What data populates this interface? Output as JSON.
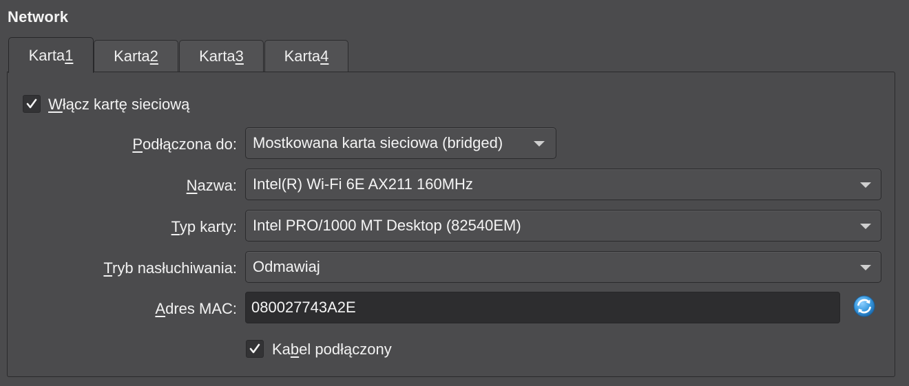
{
  "section": {
    "title": "Network"
  },
  "tabs": [
    {
      "prefix": "Karta ",
      "mnemonic": "1",
      "active": true
    },
    {
      "prefix": "Karta ",
      "mnemonic": "2",
      "active": false
    },
    {
      "prefix": "Karta ",
      "mnemonic": "3",
      "active": false
    },
    {
      "prefix": "Karta ",
      "mnemonic": "4",
      "active": false
    }
  ],
  "enable_adapter": {
    "checked": true,
    "mnemonic": "W",
    "rest": "łącz kartę sieciową"
  },
  "fields": {
    "attached_to": {
      "label_mnemonic": "P",
      "label_rest": "odłączona do:",
      "value": "Mostkowana karta sieciowa (bridged)"
    },
    "name": {
      "label_mnemonic": "N",
      "label_rest": "azwa:",
      "value": "Intel(R) Wi-Fi 6E AX211 160MHz"
    },
    "adapter_type": {
      "label_mnemonic": "T",
      "label_rest": "yp karty:",
      "value": "Intel PRO/1000 MT Desktop (82540EM)"
    },
    "promiscuous_mode": {
      "label_mnemonic": "T",
      "label_rest": "ryb nasłuchiwania:",
      "value": "Odmawiaj"
    },
    "mac": {
      "label_mnemonic": "A",
      "label_rest": "dres MAC:",
      "value": "080027743A2E"
    }
  },
  "cable_connected": {
    "checked": true,
    "pre": "Ka",
    "mnemonic": "b",
    "rest": "el podłączony"
  },
  "icons": {
    "check": "check-icon",
    "dropdown": "chevron-down-icon",
    "refresh": "refresh-icon"
  },
  "colors": {
    "background": "#4b4b4d",
    "input_dark": "#2d2d2f",
    "refresh_blue": "#3a9be0"
  }
}
